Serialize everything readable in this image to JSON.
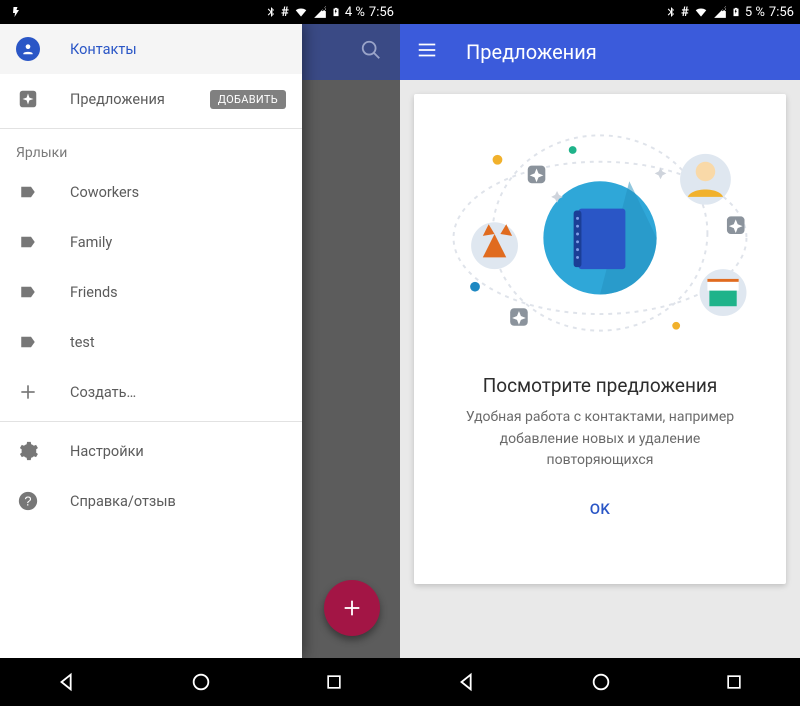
{
  "status": {
    "battery_left": "4 %",
    "battery_right": "5 %",
    "time": "7:56"
  },
  "left": {
    "drawer": {
      "contacts": "Контакты",
      "suggestions": "Предложения",
      "add_chip": "ДОБАВИТЬ",
      "labels_header": "Ярлыки",
      "labels": [
        "Coworkers",
        "Family",
        "Friends",
        "test"
      ],
      "create": "Создать…",
      "settings": "Настройки",
      "help": "Справка/отзыв"
    }
  },
  "right": {
    "title": "Предложения",
    "card": {
      "heading": "Посмотрите предложения",
      "body": "Удобная работа с контактами, например добавление новых и удаление повторяющихся",
      "ok": "OK"
    }
  },
  "colors": {
    "primary": "#3b5bdb",
    "accent": "#2a56c6",
    "fab": "#a31545"
  }
}
